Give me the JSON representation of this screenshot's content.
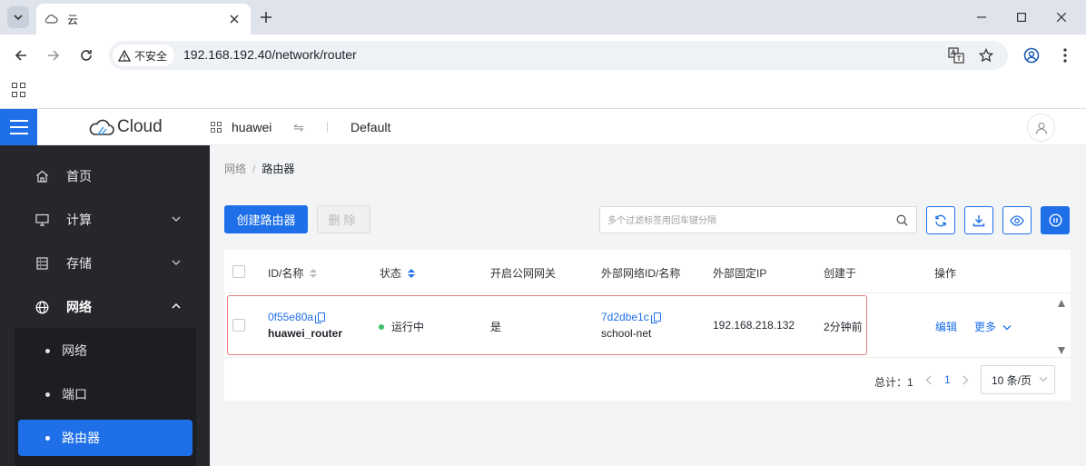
{
  "browser": {
    "tab_title": "云",
    "insecure_label": "不安全",
    "url": "192.168.192.40/network/router"
  },
  "header": {
    "logo_text": "Cloud",
    "project": "huawei",
    "swap_symbol": "⇋",
    "region": "Default"
  },
  "sidebar": {
    "items": [
      {
        "label": "首页",
        "icon": "home-icon"
      },
      {
        "label": "计算",
        "icon": "monitor-icon"
      },
      {
        "label": "存储",
        "icon": "storage-icon"
      },
      {
        "label": "网络",
        "icon": "globe-icon"
      }
    ],
    "sub_items": [
      {
        "label": "网络"
      },
      {
        "label": "端口"
      },
      {
        "label": "路由器"
      }
    ]
  },
  "breadcrumb": {
    "parent": "网络",
    "separator": "/",
    "current": "路由器"
  },
  "toolbar": {
    "create_label": "创建路由器",
    "delete_label": "删除",
    "search_placeholder": "多个过滤标签用回车键分隔"
  },
  "table": {
    "columns": {
      "id_name": "ID/名称",
      "status": "状态",
      "gateway": "开启公网网关",
      "ext_net": "外部网络ID/名称",
      "fixed_ip": "外部固定IP",
      "created": "创建于",
      "actions": "操作"
    },
    "rows": [
      {
        "id": "0f55e80a",
        "name": "huawei_router",
        "status": "运行中",
        "gateway": "是",
        "ext_net_id": "7d2dbe1c",
        "ext_net_name": "school-net",
        "fixed_ip": "192.168.218.132",
        "created": "2分钟前",
        "edit": "编辑",
        "more": "更多"
      }
    ]
  },
  "pagination": {
    "total_label": "总计：1",
    "current_page": "1",
    "page_size": "10 条/页"
  },
  "colors": {
    "primary": "#1e6fe8",
    "sidebar_bg": "#26272c",
    "status_running": "#3fc06a",
    "highlight_border": "#e87b7b"
  }
}
